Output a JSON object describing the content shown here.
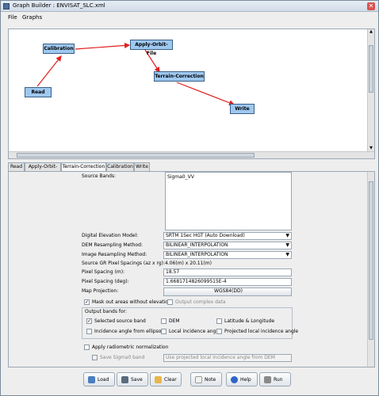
{
  "window": {
    "title": "Graph Builder : ENVISAT_SLC.xml"
  },
  "menu": {
    "file": "File",
    "graphs": "Graphs"
  },
  "graph": {
    "nodes": {
      "read": "Read",
      "calibration": "Calibration",
      "apply_orbit": "Apply-Orbit-File",
      "terrain": "Terrain-Correction",
      "write": "Write"
    }
  },
  "tabs": [
    "Read",
    "Apply-Orbit-File",
    "Terrain-Correction",
    "Calibration",
    "Write"
  ],
  "form": {
    "source_bands_label": "Source Bands:",
    "source_band_item": "Sigma0_VV",
    "dem_model_label": "Digital Elevation Model:",
    "dem_model_value": "SRTM 1Sec HGT (Auto Download)",
    "dem_resampling_label": "DEM Resampling Method:",
    "dem_resampling_value": "BILINEAR_INTERPOLATION",
    "img_resampling_label": "Image Resampling Method:",
    "img_resampling_value": "BILINEAR_INTERPOLATION",
    "gr_spacing_label": "Source GR Pixel Spacings (az x rg):",
    "gr_spacing_value": "4.06(m) x 20.11(m)",
    "pixel_m_label": "Pixel Spacing (m):",
    "pixel_m_value": "18.57",
    "pixel_deg_label": "Pixel Spacing (deg):",
    "pixel_deg_value": "1.6681714826099515E-4",
    "map_proj_label": "Map Projection:",
    "map_proj_value": "WGS84(DD)",
    "mask_label": "Mask out areas without elevation",
    "output_complex_label": "Output complex data",
    "output_bands_label": "Output bands for:",
    "selected_source_label": "Selected source band",
    "dem_label": "DEM",
    "latlon_label": "Latitude & Longitude",
    "inc_ellipsoid_label": "Incidence angle from ellipsoid",
    "local_inc_label": "Local incidence angle",
    "proj_local_inc_label": "Projected local incidence angle",
    "radiometric_label": "Apply radiometric normalization",
    "save_sigma_label": "Save Sigma0 band",
    "save_sigma_combo": "Use projected local incidence angle from DEM"
  },
  "buttons": {
    "load": "Load",
    "save": "Save",
    "clear": "Clear",
    "note": "Note",
    "help": "Help",
    "run": "Run"
  }
}
